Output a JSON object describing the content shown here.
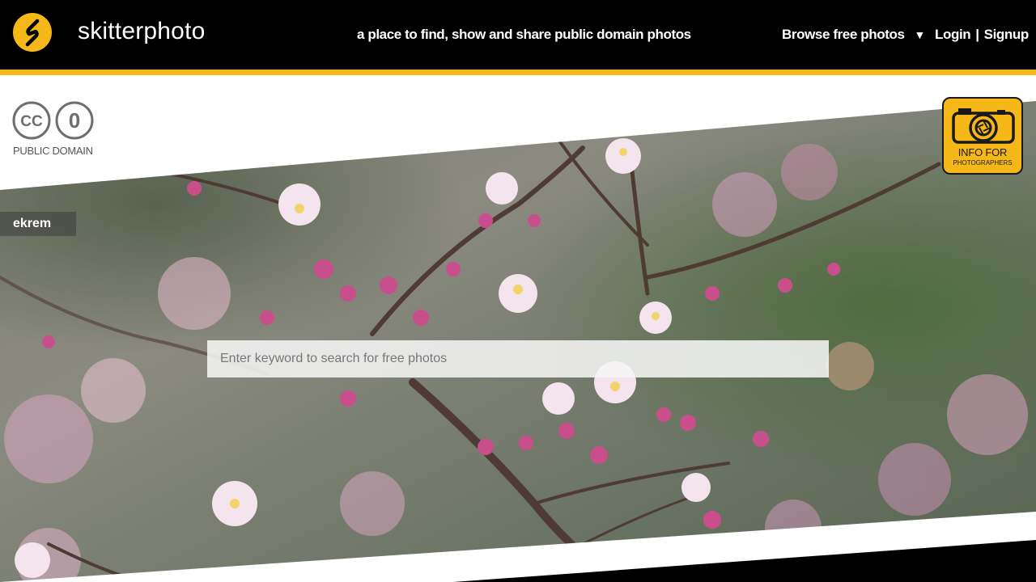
{
  "header": {
    "site_name": "skitterphoto",
    "tagline": "a place to find, show and share public domain photos",
    "browse_label": "Browse free photos",
    "browse_caret": "▼",
    "login_label": "Login",
    "separator": "|",
    "signup_label": "Signup"
  },
  "badge": {
    "cc_text": "CC",
    "zero_text": "0",
    "label": "PUBLIC DOMAIN"
  },
  "info_button": {
    "line1": "INFO FOR",
    "line2": "PHOTOGRAPHERS"
  },
  "photo": {
    "author": "ekrem",
    "subject_icon": "almond-blossom-photo"
  },
  "search": {
    "placeholder": "Enter keyword to search for free photos",
    "value": ""
  },
  "colors": {
    "accent": "#f6b819",
    "header_bg": "#000000"
  }
}
